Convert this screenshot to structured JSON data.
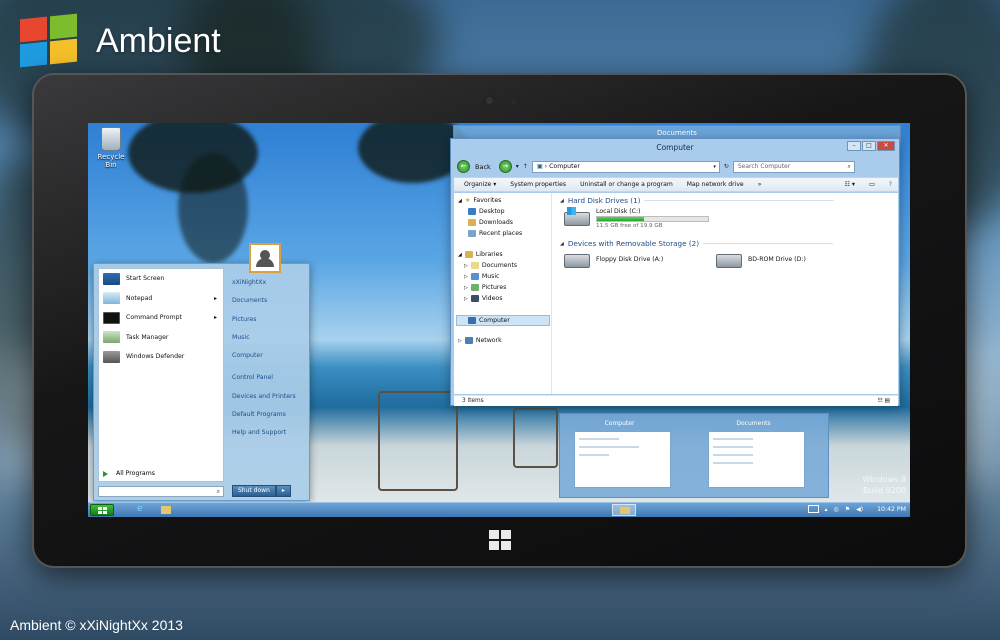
{
  "brand": {
    "title": "Ambient"
  },
  "copyright": "Ambient © xXiNightXx 2013",
  "desktop": {
    "recycle_bin": "Recycle Bin"
  },
  "start_menu": {
    "left_items": [
      {
        "label": "Start Screen",
        "icon": "start-screen-icon",
        "has_arrow": false
      },
      {
        "label": "Notepad",
        "icon": "notepad-icon",
        "has_arrow": true
      },
      {
        "label": "Command Prompt",
        "icon": "cmd-icon",
        "has_arrow": true
      },
      {
        "label": "Task Manager",
        "icon": "task-manager-icon",
        "has_arrow": false
      },
      {
        "label": "Windows Defender",
        "icon": "defender-icon",
        "has_arrow": false
      }
    ],
    "all_programs": "All Programs",
    "right_items": [
      "xXiNightXx",
      "Documents",
      "Pictures",
      "Music",
      "Computer",
      "Control Panel",
      "Devices and Printers",
      "Default Programs",
      "Help and Support"
    ],
    "shutdown": "Shut down",
    "shutdown_arrow": "▸"
  },
  "back_window": {
    "title": "Documents"
  },
  "explorer": {
    "title": "Computer",
    "back_label": "Back",
    "address": "Computer",
    "search_placeholder": "Search Computer",
    "commands": [
      "Organize ▾",
      "System properties",
      "Uninstall or change a program",
      "Map network drive",
      "»"
    ],
    "nav_pane": {
      "favorites": "Favorites",
      "favorites_items": [
        "Desktop",
        "Downloads",
        "Recent places"
      ],
      "libraries": "Libraries",
      "libraries_items": [
        "Documents",
        "Music",
        "Pictures",
        "Videos"
      ],
      "computer": "Computer",
      "network": "Network"
    },
    "groups": {
      "hard_disk": "Hard Disk Drives (1)",
      "removable": "Devices with Removable Storage (2)"
    },
    "drives": {
      "local_name": "Local Disk (C:)",
      "local_free": "11.5 GB free of 19.9 GB",
      "local_used_fraction": 0.42,
      "floppy": "Floppy Disk Drive (A:)",
      "bdrom": "BD-ROM Drive (D:)"
    },
    "status": "3 items"
  },
  "thumbnails": [
    {
      "title": "Computer"
    },
    {
      "title": "Documents"
    }
  ],
  "watermark": {
    "line1": "Windows 8",
    "line2": "Build 9200"
  },
  "taskbar": {
    "clock": "10:42 PM"
  },
  "colors": {
    "accent": "#3d78b3",
    "start_green": "#1c9b2c",
    "disk_bar": "#2aa02a"
  }
}
